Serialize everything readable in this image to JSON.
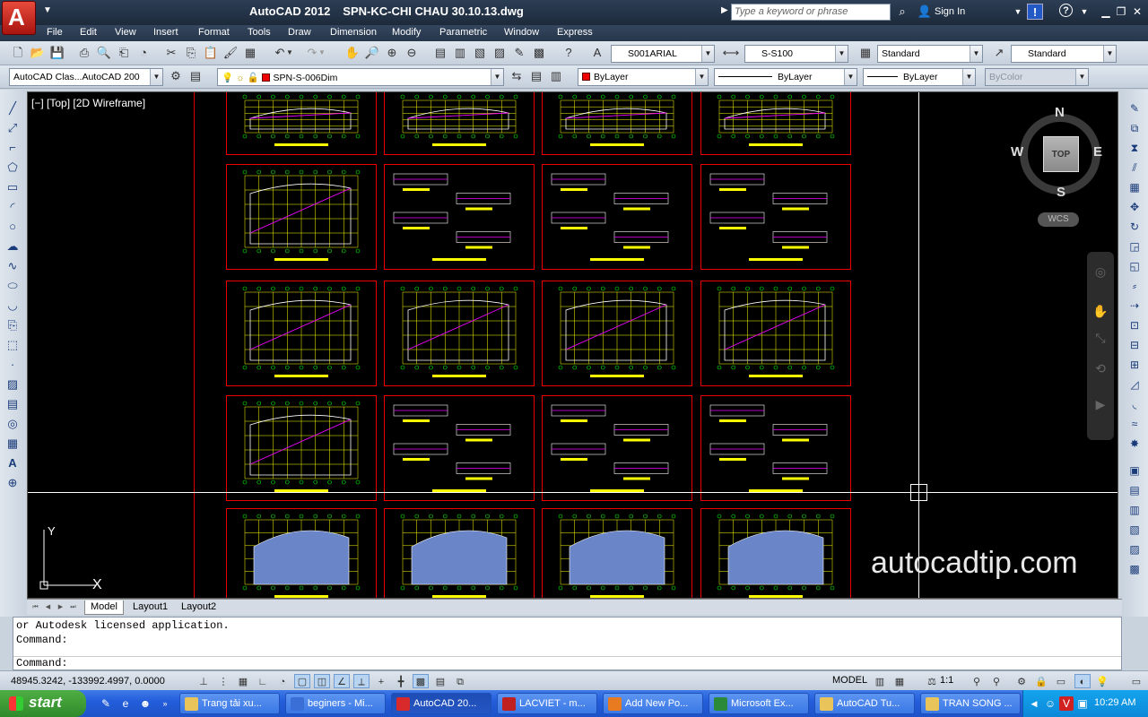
{
  "titlebar": {
    "app_name": "AutoCAD 2012",
    "document": "SPN-KC-CHI CHAU 30.10.13.dwg",
    "search_placeholder": "Type a keyword or phrase",
    "sign_in": "Sign In"
  },
  "menu": [
    "File",
    "Edit",
    "View",
    "Insert",
    "Format",
    "Tools",
    "Draw",
    "Dimension",
    "Modify",
    "Parametric",
    "Window",
    "Express"
  ],
  "toolbar1": {
    "text_style": "S001ARIAL",
    "dim_style": "S-S100",
    "table_style": "Standard",
    "mleader_style": "Standard"
  },
  "toolbar2": {
    "workspace": "AutoCAD Clas...AutoCAD 200",
    "layer": "SPN-S-006Dim",
    "color": "ByLayer",
    "linetype": "ByLayer",
    "lineweight": "ByLayer",
    "plotstyle": "ByColor"
  },
  "viewport": {
    "label": "[−] [Top] [2D Wireframe]",
    "watermark": "autocadtip.com",
    "ucs_x": "X",
    "ucs_y": "Y"
  },
  "viewcube": {
    "north": "N",
    "south": "S",
    "east": "E",
    "west": "W",
    "face": "TOP",
    "wcs": "WCS"
  },
  "layout_tabs": [
    "Model",
    "Layout1",
    "Layout2"
  ],
  "command": {
    "line1": "or Autodesk licensed application.",
    "line2": "Command:",
    "prompt": "Command:"
  },
  "status": {
    "coordinates": "48945.3242, -133992.4997, 0.0000",
    "space": "MODEL",
    "scale": "1:1"
  },
  "taskbar": {
    "start": "start",
    "tasks": [
      {
        "label": "Trang tải xu...",
        "color": "#e8c45a"
      },
      {
        "label": "beginers - Mi...",
        "color": "#3b6fd8"
      },
      {
        "label": "AutoCAD 20...",
        "color": "#d82a2a"
      },
      {
        "label": "LACVIET - m...",
        "color": "#c02020"
      },
      {
        "label": "Add New Po...",
        "color": "#e87a20"
      },
      {
        "label": "Microsoft Ex...",
        "color": "#2a8a3a"
      },
      {
        "label": "AutoCAD Tu...",
        "color": "#e8c45a"
      },
      {
        "label": "TRAN SONG ...",
        "color": "#e8c45a"
      }
    ],
    "clock": "10:29 AM"
  },
  "colors": {
    "sheet_border": "#ee0000",
    "canvas_bg": "#000000",
    "crosshair": "#ffffff"
  }
}
